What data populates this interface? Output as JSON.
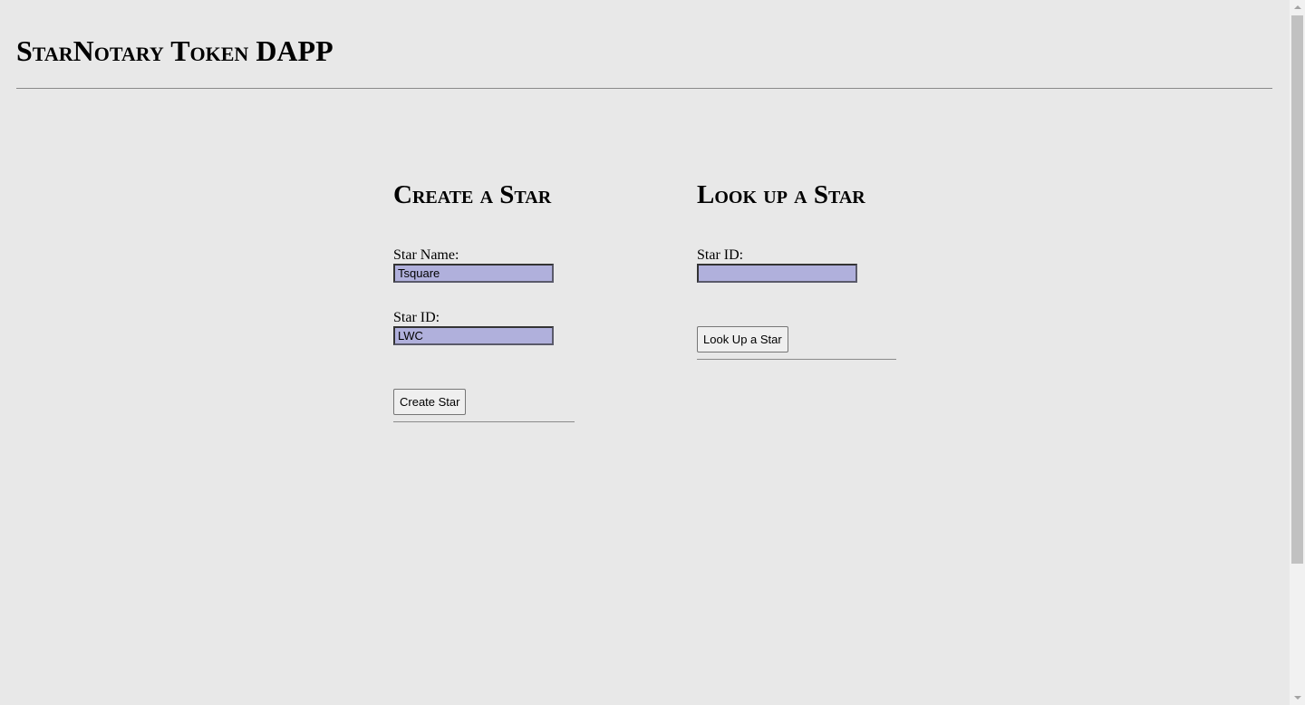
{
  "app": {
    "title": "StarNotary Token DAPP"
  },
  "create_section": {
    "heading": "Create a Star",
    "star_name_label": "Star Name:",
    "star_name_value": "Tsquare",
    "star_id_label": "Star ID:",
    "star_id_value": "LWC",
    "button_label": "Create Star"
  },
  "lookup_section": {
    "heading": "Look up a Star",
    "star_id_label": "Star ID:",
    "star_id_value": "",
    "button_label": "Look Up a Star"
  },
  "colors": {
    "page_background": "#e8e8e8",
    "input_background": "#b0b0dc"
  }
}
